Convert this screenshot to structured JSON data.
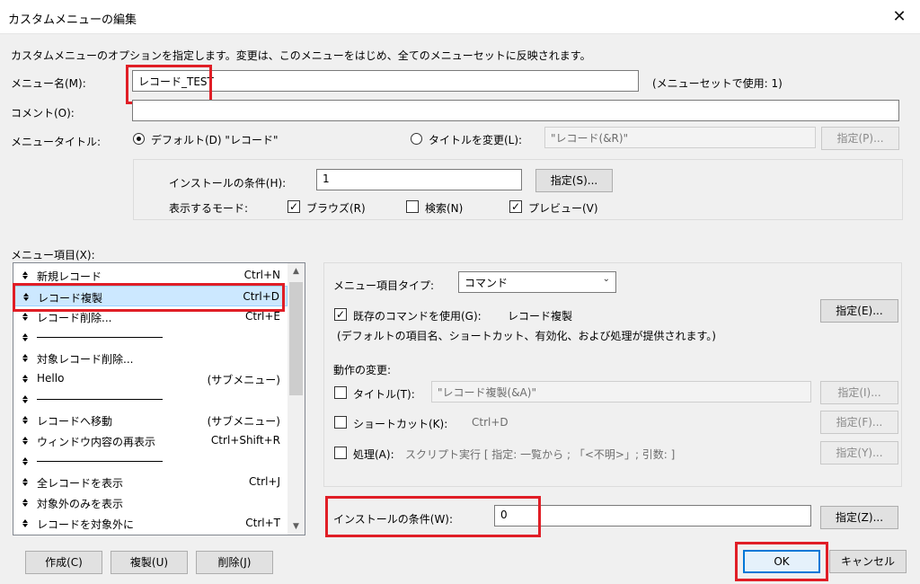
{
  "window": {
    "title": "カスタムメニューの編集",
    "close_glyph": "✕"
  },
  "description": "カスタムメニューのオプションを指定します。変更は、このメニューをはじめ、全てのメニューセットに反映されます。",
  "menu_name": {
    "label": "メニュー名(M):",
    "value": "レコード_TEST",
    "usage": "(メニューセットで使用: 1)"
  },
  "comment": {
    "label": "コメント(O):",
    "value": ""
  },
  "menu_title": {
    "label": "メニュータイトル:",
    "default_option": "デフォルト(D) \"レコード\"",
    "change_option": "タイトルを変更(L):",
    "change_value": "\"レコード(&R)\"",
    "specify_button": "指定(P)..."
  },
  "install": {
    "label": "インストールの条件(H):",
    "value": "1",
    "specify_button": "指定(S)...",
    "mode_label": "表示するモード:",
    "modes": [
      {
        "label": "ブラウズ(R)",
        "checked": true
      },
      {
        "label": "検索(N)",
        "checked": false
      },
      {
        "label": "プレビュー(V)",
        "checked": true
      }
    ]
  },
  "menu_items": {
    "label": "メニュー項目(X):",
    "items": [
      {
        "name": "新規レコード",
        "shortcut": "Ctrl+N",
        "separator": false
      },
      {
        "name": "レコード複製",
        "shortcut": "Ctrl+D",
        "separator": false,
        "selected": true
      },
      {
        "name": "レコード削除...",
        "shortcut": "Ctrl+E",
        "separator": false
      },
      {
        "name": "",
        "shortcut": "",
        "separator": true
      },
      {
        "name": "対象レコード削除...",
        "shortcut": "",
        "separator": false
      },
      {
        "name": "Hello",
        "shortcut": "(サブメニュー)",
        "separator": false
      },
      {
        "name": "",
        "shortcut": "",
        "separator": true
      },
      {
        "name": "レコードへ移動",
        "shortcut": "(サブメニュー)",
        "separator": false
      },
      {
        "name": "ウィンドウ内容の再表示",
        "shortcut": "Ctrl+Shift+R",
        "separator": false
      },
      {
        "name": "",
        "shortcut": "",
        "separator": true
      },
      {
        "name": "全レコードを表示",
        "shortcut": "Ctrl+J",
        "separator": false
      },
      {
        "name": "対象外のみを表示",
        "shortcut": "",
        "separator": false
      },
      {
        "name": "レコードを対象外に",
        "shortcut": "Ctrl+T",
        "separator": false
      }
    ]
  },
  "item_panel": {
    "type_label": "メニュー項目タイプ:",
    "type_value": "コマンド",
    "use_existing_label": "既存のコマンドを使用(G):",
    "use_existing_value": "レコード複製",
    "use_existing_checked": true,
    "specify_e": "指定(E)...",
    "note": "(デフォルトの項目名、ショートカット、有効化、および処理が提供されます。)",
    "change_label": "動作の変更:",
    "title_label": "タイトル(T):",
    "title_value": "\"レコード複製(&A)\"",
    "specify_i": "指定(I)...",
    "shortcut_label": "ショートカット(K):",
    "shortcut_value": "Ctrl+D",
    "specify_f": "指定(F)...",
    "action_label": "処理(A):",
    "action_value": "スクリプト実行 [ 指定: 一覧から ; 「<不明>」; 引数: ]",
    "specify_y": "指定(Y)...",
    "install_w_label": "インストールの条件(W):",
    "install_w_value": "0",
    "specify_z": "指定(Z)..."
  },
  "bottom_buttons": {
    "create": "作成(C)",
    "duplicate": "複製(U)",
    "delete": "削除(J)",
    "ok": "OK",
    "cancel": "キャンセル"
  },
  "colors": {
    "highlight_red": "#e01e26",
    "selection": "#cce8ff",
    "default_button_border": "#0078d7"
  },
  "icons": {
    "scroll_up": "▲",
    "scroll_down": "▼",
    "dropdown": "⌄"
  }
}
